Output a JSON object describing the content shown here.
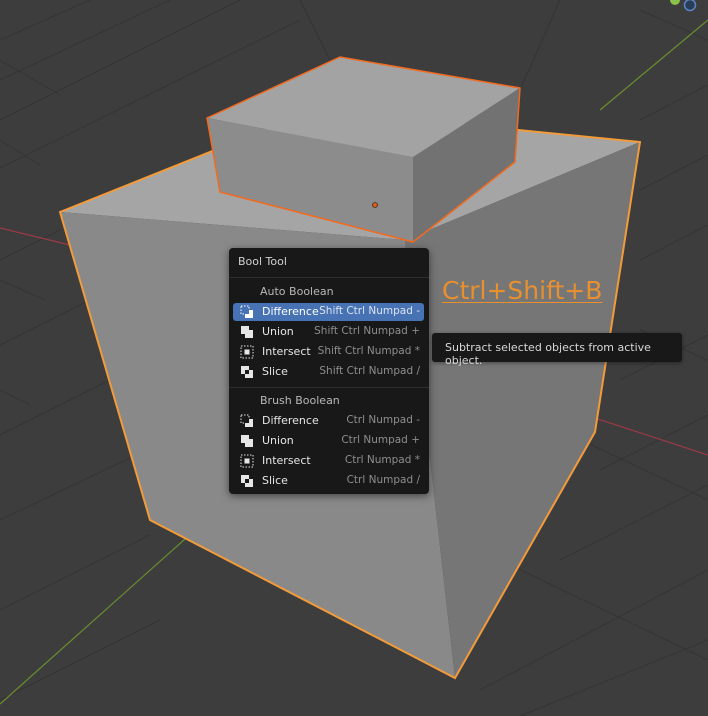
{
  "menu": {
    "title": "Bool Tool",
    "auto_section": "Auto Boolean",
    "brush_section": "Brush Boolean",
    "auto_items": [
      {
        "label": "Difference",
        "shortcut": "Shift Ctrl Numpad -",
        "icon": "difference-icon",
        "active": true
      },
      {
        "label": "Union",
        "shortcut": "Shift Ctrl Numpad +",
        "icon": "union-icon",
        "active": false
      },
      {
        "label": "Intersect",
        "shortcut": "Shift Ctrl Numpad *",
        "icon": "intersect-icon",
        "active": false
      },
      {
        "label": "Slice",
        "shortcut": "Shift Ctrl Numpad /",
        "icon": "slice-icon",
        "active": false
      }
    ],
    "brush_items": [
      {
        "label": "Difference",
        "shortcut": "Ctrl Numpad -",
        "icon": "difference-icon"
      },
      {
        "label": "Union",
        "shortcut": "Ctrl Numpad +",
        "icon": "union-icon"
      },
      {
        "label": "Intersect",
        "shortcut": "Ctrl Numpad *",
        "icon": "intersect-icon"
      },
      {
        "label": "Slice",
        "shortcut": "Ctrl Numpad /",
        "icon": "slice-icon"
      }
    ]
  },
  "tooltip": {
    "text": "Subtract selected objects from active object."
  },
  "shortcut_overlay": "Ctrl+Shift+B",
  "colors": {
    "background": "#3d3d3d",
    "selection_outline": "#f29b3a",
    "menu_bg": "#181818",
    "menu_active": "#4772b3",
    "shortcut_text": "#e8902e",
    "x_axis": "#9b3a44",
    "y_axis": "#6b8f2e"
  }
}
